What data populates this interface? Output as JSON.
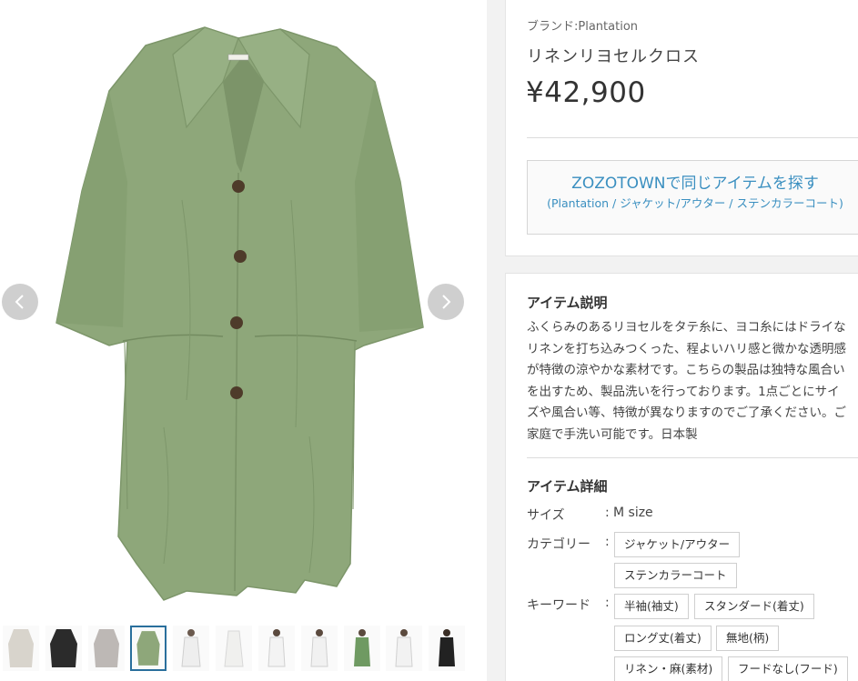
{
  "product": {
    "brand_prefix": "ブランド:",
    "brand": "Plantation",
    "name": "リネンリヨセルクロス",
    "price": "¥42,900"
  },
  "zozo": {
    "title": "ZOZOTOWNで同じアイテムを探す",
    "path": "(Plantation / ジャケット/アウター / ステンカラーコート)"
  },
  "description": {
    "title": "アイテム説明",
    "body": "ふくらみのあるリヨセルをタテ糸に、ヨコ糸にはドライな\nリネンを打ち込みつくった、程よいハリ感と微かな透明感\nが特徴の涼やかな素材です。こちらの製品は独特な風合い\nを出すため、製品洗いを行っております。1点ごとにサイ\nズや風合い等、特徴が異なりますのでご了承ください。ご\n家庭で手洗い可能です。日本製"
  },
  "details": {
    "title": "アイテム詳細",
    "size_label": "サイズ",
    "size_value": "M size",
    "category_label": "カテゴリー",
    "categories": [
      "ジャケット/アウター",
      "ステンカラーコート"
    ],
    "keyword_label": "キーワード",
    "keywords": [
      "半袖(袖丈)",
      "スタンダード(着丈)",
      "ロング丈(着丈)",
      "無地(柄)",
      "リネン・麻(素材)",
      "フードなし(フード)"
    ],
    "colon": ":"
  },
  "gallery": {
    "prev_icon": "chevron-left-icon",
    "next_icon": "chevron-right-icon",
    "selected_thumbnail": 4,
    "thumbnail_count": 12
  },
  "colors": {
    "coat": "#8ea77a",
    "link": "#3a8fc0",
    "selected_border": "#2a6f9c"
  }
}
